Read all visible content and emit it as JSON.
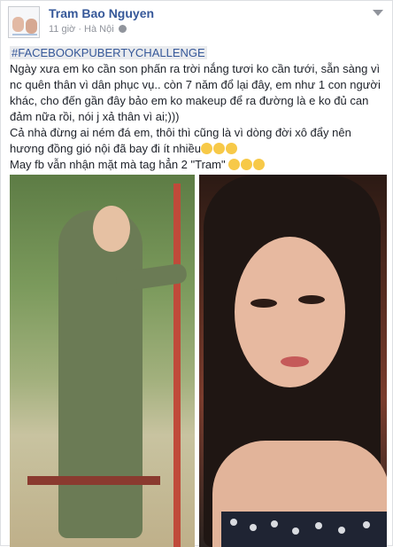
{
  "post": {
    "author": "Tram Bao Nguyen",
    "time": "11 giờ",
    "location": "Hà Nội",
    "hashtag": "#FACEBOOKPUBERTYCHALLENGE",
    "paragraph1": "Ngày xưa em ko cần son phấn ra trời nắng tươi ko cần tưới, sẵn sàng vì nc quên thân vì dân phục vụ.. còn 7 năm đổ lại đây, em như 1 con người khác, cho đến gần đây bảo em ko makeup để ra đường là e ko đủ can đảm nữa rồi, nói j xả thân vì ai;)))",
    "paragraph2": "Cả nhà đừng ai ném đá em, thôi thì cũng là vì dòng đời xô đẩy nên hương đồng gió nội đã bay đi ít nhiều",
    "paragraph3": "May fb vẫn nhận mặt mà tag hẳn 2 \"Tram\""
  },
  "icons": {
    "avatar": "profile-avatar",
    "globe": "globe-icon",
    "chevron": "chevron-down-icon",
    "laugh": "rofl-emoji",
    "smile": "smile-emoji"
  },
  "colors": {
    "link": "#365899",
    "text": "#1d2129",
    "meta": "#90949c",
    "hashtag_bg": "#e9ebee"
  }
}
